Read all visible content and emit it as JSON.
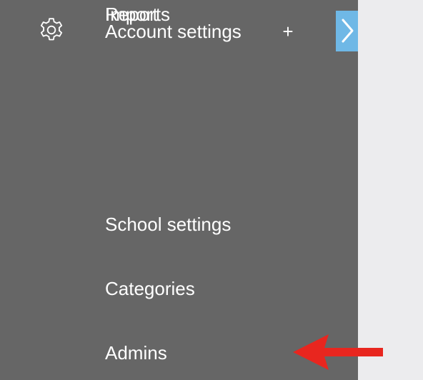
{
  "sidebar": {
    "background_color": "#666666",
    "account": {
      "icon": "gear-icon",
      "label": "Account settings",
      "expand_symbol": "+"
    },
    "collapse_tab": {
      "icon": "chevron-right-icon",
      "color": "#6fb8e6"
    },
    "items": [
      {
        "label": "School settings"
      },
      {
        "label": "Categories"
      },
      {
        "label": "Admins"
      },
      {
        "label": "Reports"
      },
      {
        "label": "Import"
      }
    ]
  },
  "annotation": {
    "icon": "arrow-left-icon",
    "color": "#e8261f"
  },
  "page": {
    "background_color": "#ececee"
  }
}
